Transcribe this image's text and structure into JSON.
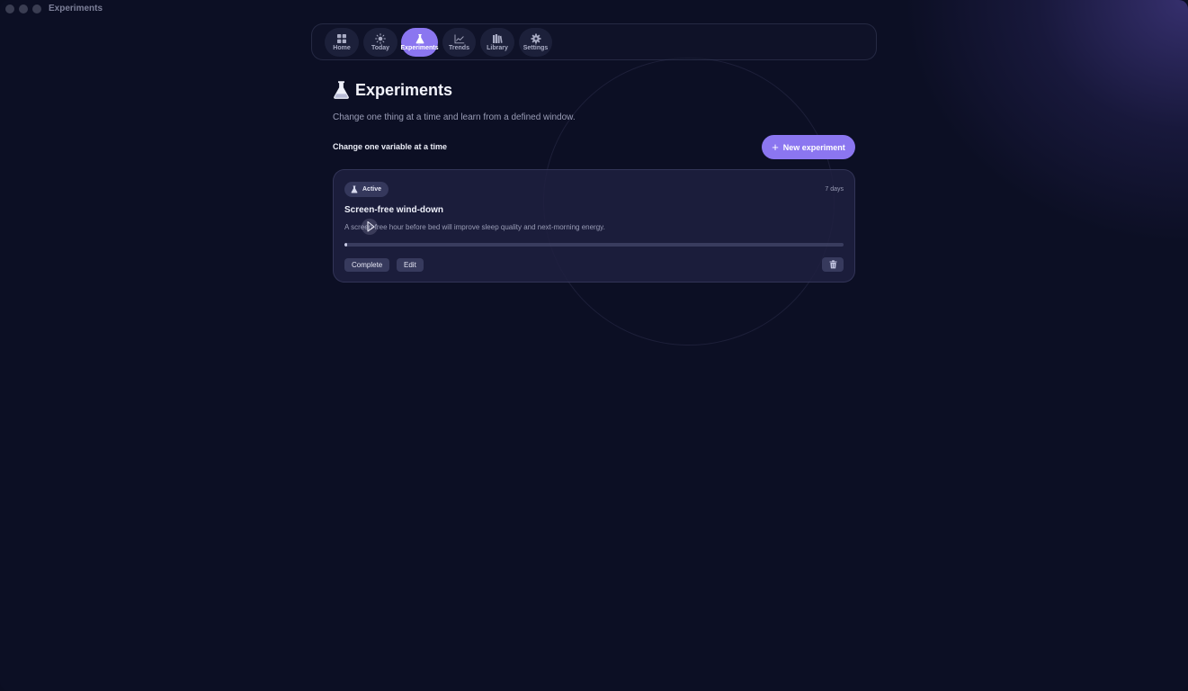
{
  "window": {
    "title": "Experiments"
  },
  "nav": {
    "items": [
      {
        "label": "Home",
        "icon": "grid-icon",
        "active": false
      },
      {
        "label": "Today",
        "icon": "sun-icon",
        "active": false
      },
      {
        "label": "Experiments",
        "icon": "flask-icon",
        "active": true
      },
      {
        "label": "Trends",
        "icon": "chart-line-icon",
        "active": false
      },
      {
        "label": "Library",
        "icon": "books-icon",
        "active": false
      },
      {
        "label": "Settings",
        "icon": "gear-icon",
        "active": false
      }
    ]
  },
  "page": {
    "title": "Experiments",
    "subtitle": "Change one thing at a time and learn from a defined window.",
    "section_title": "Change one variable at a time",
    "new_button_label": "New experiment"
  },
  "experiments": [
    {
      "status": "Active",
      "duration": "7 days",
      "title": "Screen-free wind-down",
      "description": "A screen-free hour before bed will improve sleep quality and next-morning energy.",
      "progress": 0.005,
      "complete_label": "Complete",
      "edit_label": "Edit"
    }
  ],
  "colors": {
    "accent": "#8b76f0",
    "background": "#0c0f24",
    "card": "#1e2040"
  }
}
